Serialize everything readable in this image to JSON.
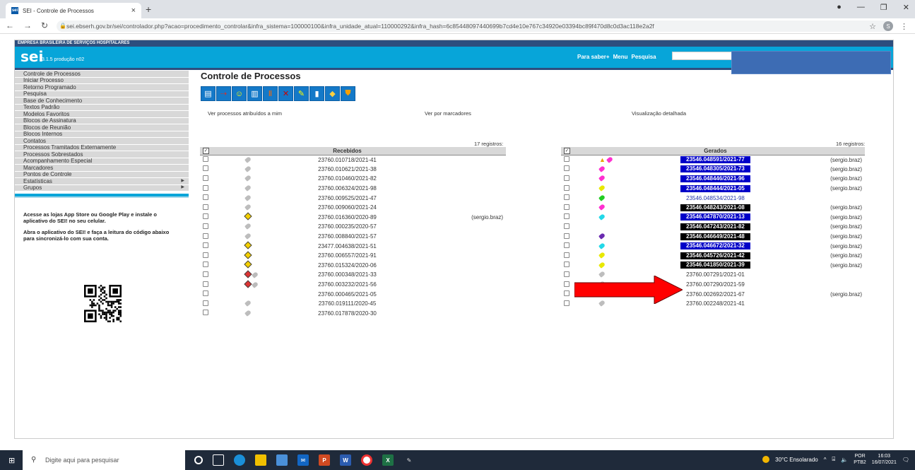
{
  "browser": {
    "tab_title": "SEI - Controle de Processos",
    "tab_favicon": "sei",
    "url": "sei.ebserh.gov.br/sei/controlador.php?acao=procedimento_controlar&infra_sistema=100000100&infra_unidade_atual=110000292&infra_hash=6c85448097440699b7cd4e10e767c34920e03394bc89f470d8c0d3ac118e2a2f",
    "profile_initial": "S"
  },
  "sei": {
    "org_name": "EMPRESA BRASILEIRA DE SERVIÇOS HOSPITALARES",
    "logo": "sei",
    "version": "3.1.5 produção n02",
    "header_links": [
      "Para saber+",
      "Menu",
      "Pesquisa"
    ],
    "menu": [
      {
        "label": "Controle de Processos",
        "arrow": ""
      },
      {
        "label": "Iniciar Processo",
        "arrow": ""
      },
      {
        "label": "Retorno Programado",
        "arrow": ""
      },
      {
        "label": "Pesquisa",
        "arrow": ""
      },
      {
        "label": "Base de Conhecimento",
        "arrow": ""
      },
      {
        "label": "Textos Padrão",
        "arrow": ""
      },
      {
        "label": "Modelos Favoritos",
        "arrow": ""
      },
      {
        "label": "Blocos de Assinatura",
        "arrow": ""
      },
      {
        "label": "Blocos de Reunião",
        "arrow": ""
      },
      {
        "label": "Blocos Internos",
        "arrow": ""
      },
      {
        "label": "Contatos",
        "arrow": ""
      },
      {
        "label": "Processos Tramitados Externamente",
        "arrow": ""
      },
      {
        "label": "Processos Sobrestados",
        "arrow": ""
      },
      {
        "label": "Acompanhamento Especial",
        "arrow": ""
      },
      {
        "label": "Marcadores",
        "arrow": ""
      },
      {
        "label": "Pontos de Controle",
        "arrow": ""
      },
      {
        "label": "Estatísticas",
        "arrow": "▶"
      },
      {
        "label": "Grupos",
        "arrow": "▶"
      }
    ],
    "app_text_1": "Acesse as lojas App Store ou Google Play e instale o aplicativo do SEI! no seu celular.",
    "app_text_2": "Abra o aplicativo do SEI! e faça a leitura do código abaixo para sincronizá-lo com sua conta."
  },
  "main": {
    "title": "Controle de Processos",
    "toolbar_icons": [
      "new-process-icon",
      "send-process-icon",
      "assign-icon",
      "sign-block-icon",
      "conclude-icon",
      "remove-icon",
      "annotation-icon",
      "document-icon",
      "marker-icon",
      "shield-icon"
    ],
    "view_assigned": "Ver processos atribuídos a mim",
    "view_markers": "Ver por marcadores",
    "view_detailed": "Visualização detalhada",
    "received": {
      "count_label": "17 registros:",
      "header": "Recebidos",
      "rows": [
        {
          "number": "23760.010718/2021-41",
          "marker": "gray",
          "user": ""
        },
        {
          "number": "23760.010621/2021-38",
          "marker": "gray",
          "user": ""
        },
        {
          "number": "23760.010460/2021-82",
          "marker": "gray",
          "user": ""
        },
        {
          "number": "23760.006324/2021-98",
          "marker": "gray",
          "user": ""
        },
        {
          "number": "23760.009525/2021-47",
          "marker": "gray",
          "user": ""
        },
        {
          "number": "23760.009060/2021-24",
          "marker": "gray",
          "user": ""
        },
        {
          "number": "23760.016360/2020-89",
          "marker": "note",
          "user": "(sergio.braz)"
        },
        {
          "number": "23760.000235/2020-57",
          "marker": "gray",
          "user": ""
        },
        {
          "number": "23760.008840/2021-57",
          "marker": "gray",
          "user": ""
        },
        {
          "number": "23477.004638/2021-51",
          "marker": "note",
          "user": ""
        },
        {
          "number": "23760.006557/2021-91",
          "marker": "note",
          "user": ""
        },
        {
          "number": "23760.015324/2020-06",
          "marker": "note",
          "user": ""
        },
        {
          "number": "23760.000348/2021-33",
          "marker": "note-gray",
          "user": ""
        },
        {
          "number": "23760.003232/2021-56",
          "marker": "note-gray",
          "user": ""
        },
        {
          "number": "23760.000465/2021-05",
          "marker": "",
          "user": ""
        },
        {
          "number": "23760.019111/2020-45",
          "marker": "gray",
          "user": ""
        },
        {
          "number": "23760.017878/2020-30",
          "marker": "gray",
          "user": ""
        }
      ]
    },
    "generated": {
      "count_label": "16 registros:",
      "header": "Gerados",
      "rows": [
        {
          "number": "23546.048591/2021-77",
          "style": "blue",
          "marker": "warn-pink",
          "user": "(sergio.braz)"
        },
        {
          "number": "23546.048305/2021-73",
          "style": "blue",
          "marker": "#ff2fd0",
          "user": "(sergio.braz)"
        },
        {
          "number": "23546.048446/2021-96",
          "style": "blue",
          "marker": "#ff2fd0",
          "user": "(sergio.braz)"
        },
        {
          "number": "23546.048444/2021-05",
          "style": "blue",
          "marker": "#e8e800",
          "user": "(sergio.braz)"
        },
        {
          "number": "23546.048534/2021-98",
          "style": "link",
          "marker": "#22cc22",
          "user": ""
        },
        {
          "number": "23546.048243/2021-08",
          "style": "black",
          "marker": "#ff2fd0",
          "user": "(sergio.braz)"
        },
        {
          "number": "23546.047870/2021-13",
          "style": "blue",
          "marker": "#22d8e8",
          "user": "(sergio.braz)"
        },
        {
          "number": "23546.047243/2021-82",
          "style": "black",
          "marker": "",
          "user": "(sergio.braz)"
        },
        {
          "number": "23546.046649/2021-48",
          "style": "black",
          "marker": "#6a2ab0",
          "user": "(sergio.braz)"
        },
        {
          "number": "23546.046672/2021-32",
          "style": "blue",
          "marker": "#22d8e8",
          "user": "(sergio.braz)"
        },
        {
          "number": "23546.045726/2021-42",
          "style": "black",
          "marker": "#e8e800",
          "user": "(sergio.braz)"
        },
        {
          "number": "23546.041850/2021-39",
          "style": "black",
          "marker": "#e8e800",
          "user": "(sergio.braz)"
        },
        {
          "number": "23760.007291/2021-01",
          "style": "plain",
          "marker": "gray",
          "user": ""
        },
        {
          "number": "23760.007290/2021-59",
          "style": "plain",
          "marker": "outline",
          "user": ""
        },
        {
          "number": "23760.002692/2021-67",
          "style": "plain",
          "marker": "outline",
          "user": "(sergio.braz)"
        },
        {
          "number": "23760.002248/2021-41",
          "style": "plain",
          "marker": "gray",
          "user": ""
        }
      ]
    }
  },
  "taskbar": {
    "search_placeholder": "Digite aqui para pesquisar",
    "weather": "30°C Ensolarado",
    "lang_1": "POR",
    "lang_2": "PTB2",
    "time": "16:03",
    "date": "16/07/2021"
  },
  "colors": {
    "header_blue": "#07a5d9",
    "dark_blue": "#2d4e7e",
    "highlight_blue": "#0000c8",
    "arrow_red": "#ff0000"
  }
}
